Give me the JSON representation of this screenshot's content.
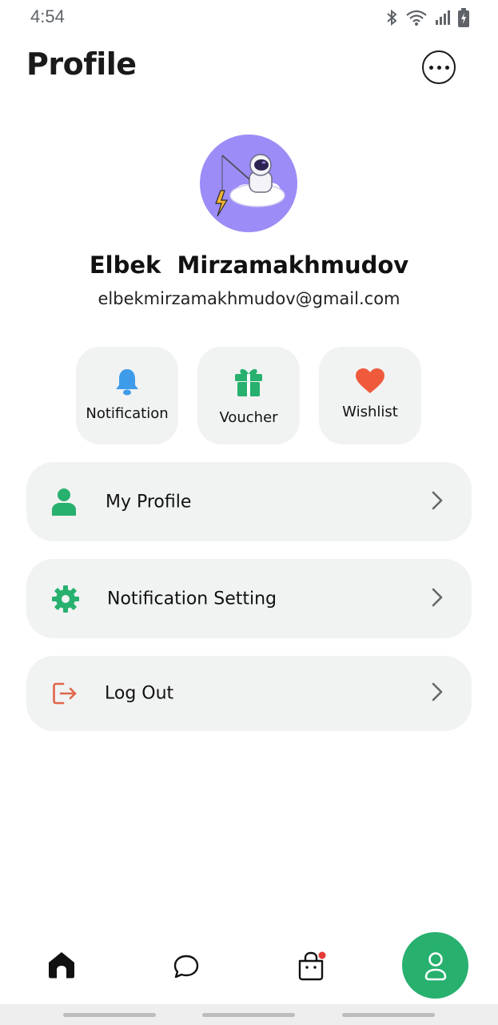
{
  "status_bar": {
    "time": "4:54"
  },
  "header": {
    "title": "Profile"
  },
  "user": {
    "name": "Elbek  Mirzamakhmudov",
    "email": "elbekmirzamakhmudov@gmail.com"
  },
  "quick_actions": [
    {
      "label": "Notification",
      "icon": "bell-icon",
      "color": "#3d9be9"
    },
    {
      "label": "Voucher",
      "icon": "gift-icon",
      "color": "#27b06e"
    },
    {
      "label": "Wishlist",
      "icon": "heart-icon",
      "color": "#ef5a3c"
    }
  ],
  "menu": [
    {
      "label": "My Profile",
      "icon": "user-icon",
      "color": "#27b06e"
    },
    {
      "label": "Notification Setting",
      "icon": "gear-icon",
      "color": "#27b06e"
    },
    {
      "label": "Log Out",
      "icon": "logout-icon",
      "color": "#e0664a"
    }
  ],
  "bottom_nav": [
    {
      "icon": "home-icon"
    },
    {
      "icon": "chat-icon"
    },
    {
      "icon": "cart-icon",
      "badge": true
    },
    {
      "icon": "profile-icon",
      "active": true
    }
  ],
  "colors": {
    "accent": "#27b06e",
    "card_bg": "#f1f2f2",
    "avatar_bg": "#9b8cf7"
  }
}
